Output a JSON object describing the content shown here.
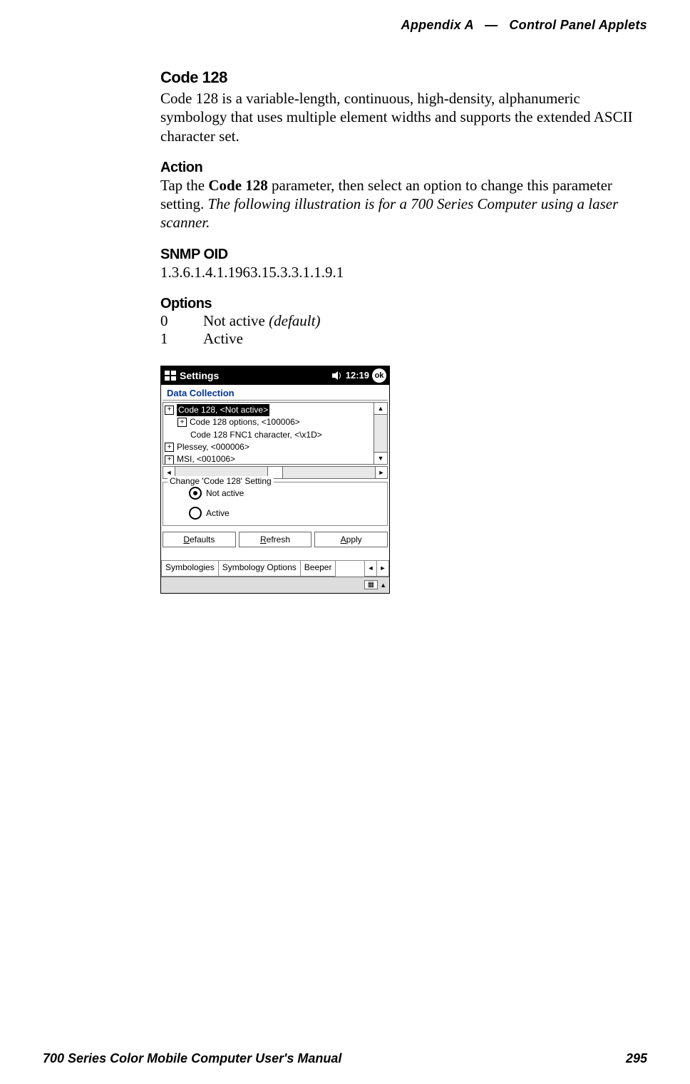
{
  "header": {
    "left": "Appendix A",
    "sep": "—",
    "right": "Control Panel Applets"
  },
  "section": {
    "title": "Code 128",
    "desc": "Code 128 is a variable-length, continuous, high-density, alphanumeric symbology that uses multiple element widths and supports the extended ASCII character set."
  },
  "action": {
    "title": "Action",
    "text_pre": "Tap the ",
    "text_bold": "Code 128",
    "text_mid": " parameter, then select an option to change this parameter setting. ",
    "text_italic": "The following illustration is for a 700 Series Computer using a laser scanner."
  },
  "snmp": {
    "title": "SNMP OID",
    "value": "1.3.6.1.4.1.1963.15.3.3.1.1.9.1"
  },
  "options": {
    "title": "Options",
    "rows": [
      {
        "num": "0",
        "label": "Not active ",
        "suffix_italic": "(default)"
      },
      {
        "num": "1",
        "label": "Active",
        "suffix_italic": ""
      }
    ]
  },
  "pda": {
    "title": "Settings",
    "time": "12:19",
    "ok": "ok",
    "subtitle": "Data Collection",
    "tree": [
      {
        "indent": 0,
        "plus": "+",
        "text": "Code 128, <Not active>",
        "highlight": true
      },
      {
        "indent": 1,
        "plus": "+",
        "text": "Code 128 options, <100006>",
        "highlight": false
      },
      {
        "indent": 2,
        "plus": "",
        "text": "Code 128 FNC1 character, <\\x1D>",
        "highlight": false
      },
      {
        "indent": 0,
        "plus": "+",
        "text": "Plessey, <000006>",
        "highlight": false
      },
      {
        "indent": 0,
        "plus": "+",
        "text": "MSI, <001006>",
        "highlight": false
      }
    ],
    "legend": "Change 'Code 128' Setting",
    "radios": [
      {
        "label": "Not active",
        "selected": true
      },
      {
        "label": "Active",
        "selected": false
      }
    ],
    "buttons": {
      "defaults": "Defaults",
      "refresh": "Refresh",
      "apply": "Apply"
    },
    "tabs": [
      "Symbologies",
      "Symbology Options",
      "Beeper"
    ]
  },
  "footer": {
    "left": "700 Series Color Mobile Computer User's Manual",
    "right": "295"
  }
}
